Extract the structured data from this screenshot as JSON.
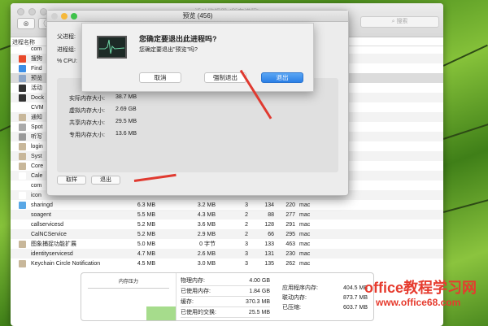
{
  "window": {
    "title": "活动监视器 (所有进程)",
    "search_placeholder": "搜索",
    "column_process_name": "进程名称"
  },
  "processes_partial": [
    "com",
    "搜狗",
    "Find",
    "预览",
    "活动",
    "Dock",
    "CVM",
    "通知",
    "Spot",
    "听写",
    "login",
    "Syst",
    "Core",
    "Cale",
    "com",
    "icon"
  ],
  "processes": [
    {
      "name": "sharingd",
      "mem": "6.3 MB",
      "comp": "3.2 MB",
      "threads": "3",
      "ports": "134",
      "pid": "220",
      "user": "mac"
    },
    {
      "name": "soagent",
      "mem": "5.5 MB",
      "comp": "4.3 MB",
      "threads": "2",
      "ports": "88",
      "pid": "277",
      "user": "mac"
    },
    {
      "name": "callservicesd",
      "mem": "5.2 MB",
      "comp": "3.6 MB",
      "threads": "2",
      "ports": "128",
      "pid": "291",
      "user": "mac"
    },
    {
      "name": "CalNCService",
      "mem": "5.2 MB",
      "comp": "2.9 MB",
      "threads": "2",
      "ports": "66",
      "pid": "295",
      "user": "mac"
    },
    {
      "name": "图象捕捉功能扩展",
      "mem": "5.0 MB",
      "comp": "0 字节",
      "threads": "3",
      "ports": "133",
      "pid": "463",
      "user": "mac"
    },
    {
      "name": "identityservicesd",
      "mem": "4.7 MB",
      "comp": "2.6 MB",
      "threads": "3",
      "ports": "131",
      "pid": "230",
      "user": "mac"
    },
    {
      "name": "Keychain Circle Notification",
      "mem": "4.5 MB",
      "comp": "3.0 MB",
      "threads": "3",
      "ports": "135",
      "pid": "262",
      "user": "mac"
    }
  ],
  "inspector": {
    "title": "预览 (456)",
    "parent_label": "父进程:",
    "group_label": "进程组:",
    "cpu_label": "% CPU:",
    "memory": [
      {
        "label": "实际内存大小:",
        "value": "38.7 MB"
      },
      {
        "label": "虚拟内存大小:",
        "value": "2.69 GB"
      },
      {
        "label": "共享内存大小:",
        "value": "29.5 MB"
      },
      {
        "label": "专用内存大小:",
        "value": "13.6 MB"
      }
    ],
    "sample_btn": "取样",
    "quit_btn": "退出"
  },
  "alert": {
    "title": "您确定要退出此进程吗?",
    "message": "您确定要退出\"预览\"吗?",
    "cancel": "取消",
    "force_quit": "强制退出",
    "quit": "退出"
  },
  "bottom": {
    "pressure_label": "内存压力",
    "pressure_level": 0.3,
    "stats1": [
      {
        "label": "物理内存:",
        "value": "4.00 GB"
      },
      {
        "label": "已使用内存:",
        "value": "1.84 GB"
      },
      {
        "label": "缓存:",
        "value": "370.3 MB"
      },
      {
        "label": "已使用的交换:",
        "value": "25.5 MB"
      }
    ],
    "stats2": [
      {
        "label": "应用程序内存:",
        "value": "404.5 MB"
      },
      {
        "label": "联动内存:",
        "value": "873.7 MB"
      },
      {
        "label": "已压缩:",
        "value": "603.7 MB"
      }
    ]
  },
  "watermark": {
    "line1": "office教程学习网",
    "line2": "www.office68.com"
  }
}
